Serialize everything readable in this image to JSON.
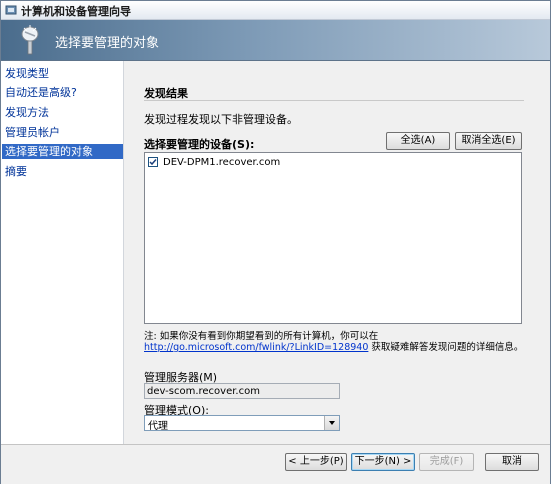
{
  "window": {
    "title": "计算机和设备管理向导"
  },
  "header": {
    "title": "选择要管理的对象",
    "icon": "tools-wand-icon"
  },
  "nav": {
    "items": [
      {
        "label": "发现类型"
      },
      {
        "label": "自动还是高级?"
      },
      {
        "label": "发现方法"
      },
      {
        "label": "管理员帐户"
      },
      {
        "label": "选择要管理的对象",
        "selected": true
      },
      {
        "label": "摘要"
      }
    ]
  },
  "content": {
    "section_title": "发现结果",
    "description": "发现过程发现以下非管理设备。",
    "devices_label": "选择要管理的设备(S):",
    "select_all_label": "全选(A)",
    "deselect_all_label": "取消全选(E)",
    "devices": [
      {
        "name": "DEV-DPM1.recover.com",
        "checked": true
      }
    ],
    "note_prefix": "注: 如果你没有看到你期望看到的所有计算机，你可以在",
    "note_link": "http://go.microsoft.com/fwlink/?LinkID=128940",
    "note_suffix": "获取疑难解答发现问题的详细信息。",
    "server_label": "管理服务器(M)",
    "server_value": "dev-scom.recover.com",
    "mode_label": "管理模式(O):",
    "mode_value": "代理"
  },
  "footer": {
    "back_label": "< 上一步(P)",
    "next_label": "下一步(N) >",
    "finish_label": "完成(F)",
    "cancel_label": "取消"
  },
  "colors": {
    "nav_selected_bg": "#3169c6",
    "nav_link": "#003399",
    "header_gradient_start": "#4a6c8c",
    "link": "#0033cc"
  }
}
